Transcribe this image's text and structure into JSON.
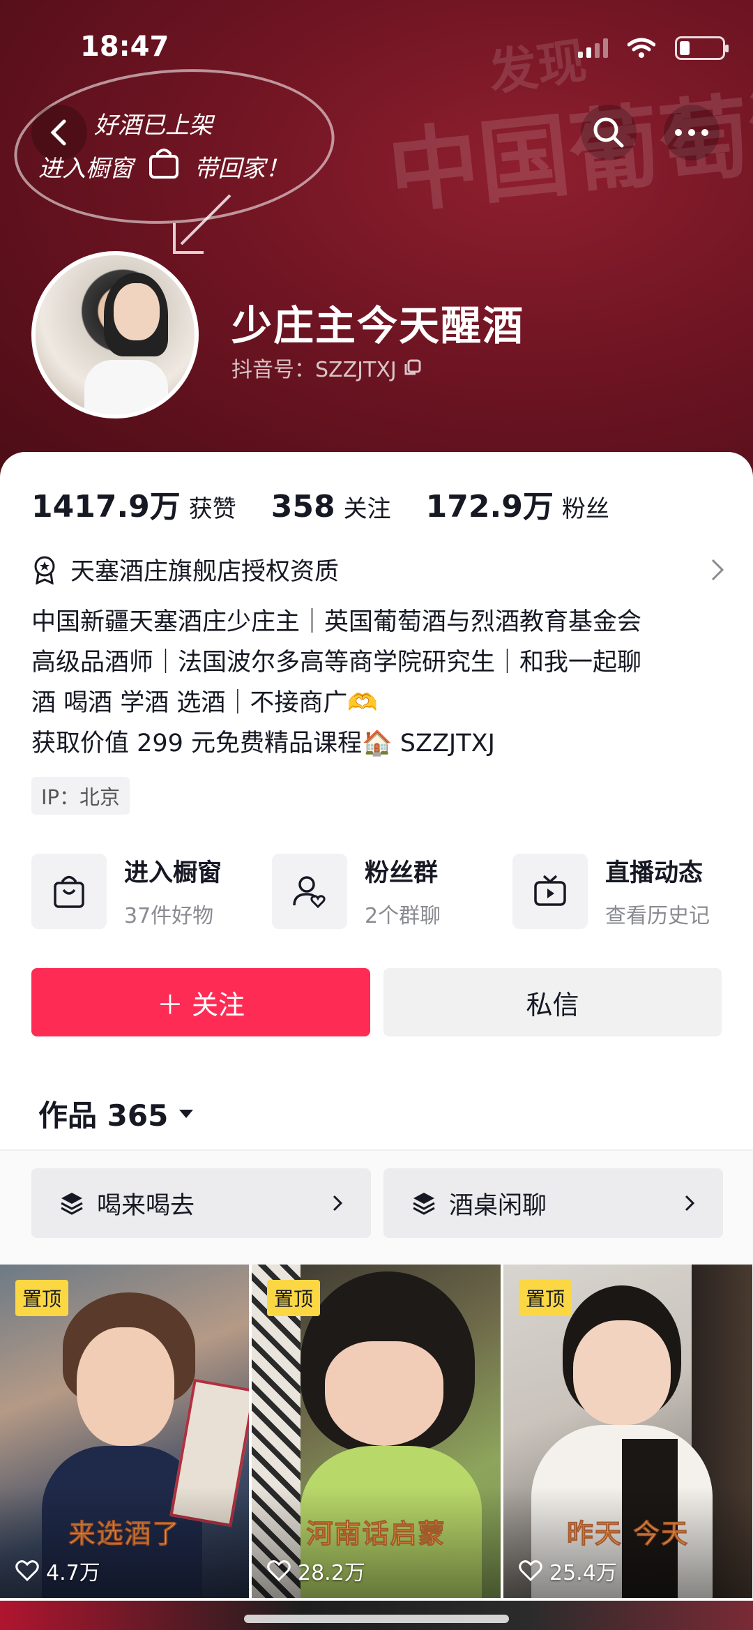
{
  "status_bar": {
    "time": "18:47"
  },
  "banner": {
    "promo_line1": "好酒已上架",
    "promo_line2_a": "进入橱窗",
    "promo_line2_b": "带回家！",
    "deco_text_1": "发现",
    "deco_text_2": "中国葡萄酒"
  },
  "profile": {
    "display_name": "少庄主今天醒酒",
    "douyin_id": "抖音号：SZZJTXJ"
  },
  "stats": [
    {
      "value": "1417.9万",
      "label": "获赞"
    },
    {
      "value": "358",
      "label": "关注"
    },
    {
      "value": "172.9万",
      "label": "粉丝"
    }
  ],
  "certification": "天塞酒庄旗舰店授权资质",
  "bio": [
    "中国新疆天塞酒庄少庄主｜英国葡萄酒与烈酒教育基金会",
    "高级品酒师｜法国波尔多高等商学院研究生｜和我一起聊",
    "酒 喝酒 学酒 选酒｜不接商广🫶",
    "获取价值 299 元免费精品课程🏠 SZZJTXJ"
  ],
  "ip_location": "IP：北京",
  "entries": [
    {
      "title": "进入橱窗",
      "subtitle": "37件好物",
      "icon": "shopping-bag-icon"
    },
    {
      "title": "粉丝群",
      "subtitle": "2个群聊",
      "icon": "fan-group-icon"
    },
    {
      "title": "直播动态",
      "subtitle": "查看历史记",
      "icon": "live-tv-icon"
    }
  ],
  "actions": {
    "follow": "＋ 关注",
    "message": "私信"
  },
  "works": {
    "label": "作品 365"
  },
  "collections": [
    {
      "label": "喝来喝去"
    },
    {
      "label": "酒桌闲聊"
    }
  ],
  "videos": [
    {
      "pinned": "置顶",
      "caption": "来选酒了",
      "likes": "4.7万"
    },
    {
      "pinned": "置顶",
      "caption": "河南话启蒙",
      "likes": "28.2万"
    },
    {
      "pinned": "置顶",
      "caption": "昨天 今天",
      "likes": "25.4万"
    }
  ],
  "colors": {
    "accent": "#fe2c55",
    "banner": "#7a1627",
    "pin": "#fbd743"
  }
}
